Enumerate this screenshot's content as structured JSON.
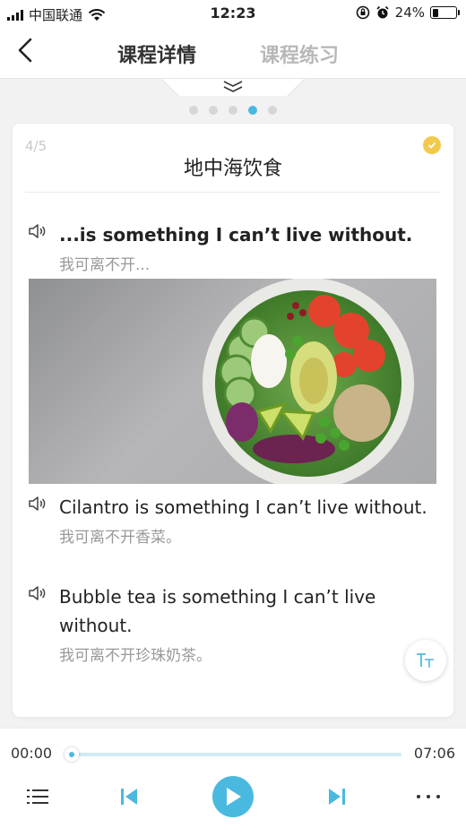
{
  "status": {
    "carrier": "中国联通",
    "time": "12:23",
    "battery": "24%",
    "battery_level": 0.24
  },
  "nav": {
    "tabs": [
      {
        "label": "课程详情",
        "active": true
      },
      {
        "label": "课程练习",
        "active": false
      }
    ]
  },
  "pager": {
    "total": 5,
    "current": 4
  },
  "lesson": {
    "counter": "4/5",
    "title": "地中海饮食",
    "sentences": [
      {
        "en": "...is something I can’t live without.",
        "zh": "我可离不开..."
      },
      {
        "en": "Cilantro is something I can’t live without.",
        "zh": "我可离不开香菜。"
      },
      {
        "en": "Bubble tea is something I can’t live without.",
        "zh": "我可离不开珍珠奶茶。"
      }
    ],
    "image_alt": "salad-bowl"
  },
  "player": {
    "current_time": "00:00",
    "total_time": "07:06",
    "progress": 0.0
  },
  "colors": {
    "accent": "#4ab9df",
    "badge": "#f2c94c",
    "muted": "#999999"
  }
}
